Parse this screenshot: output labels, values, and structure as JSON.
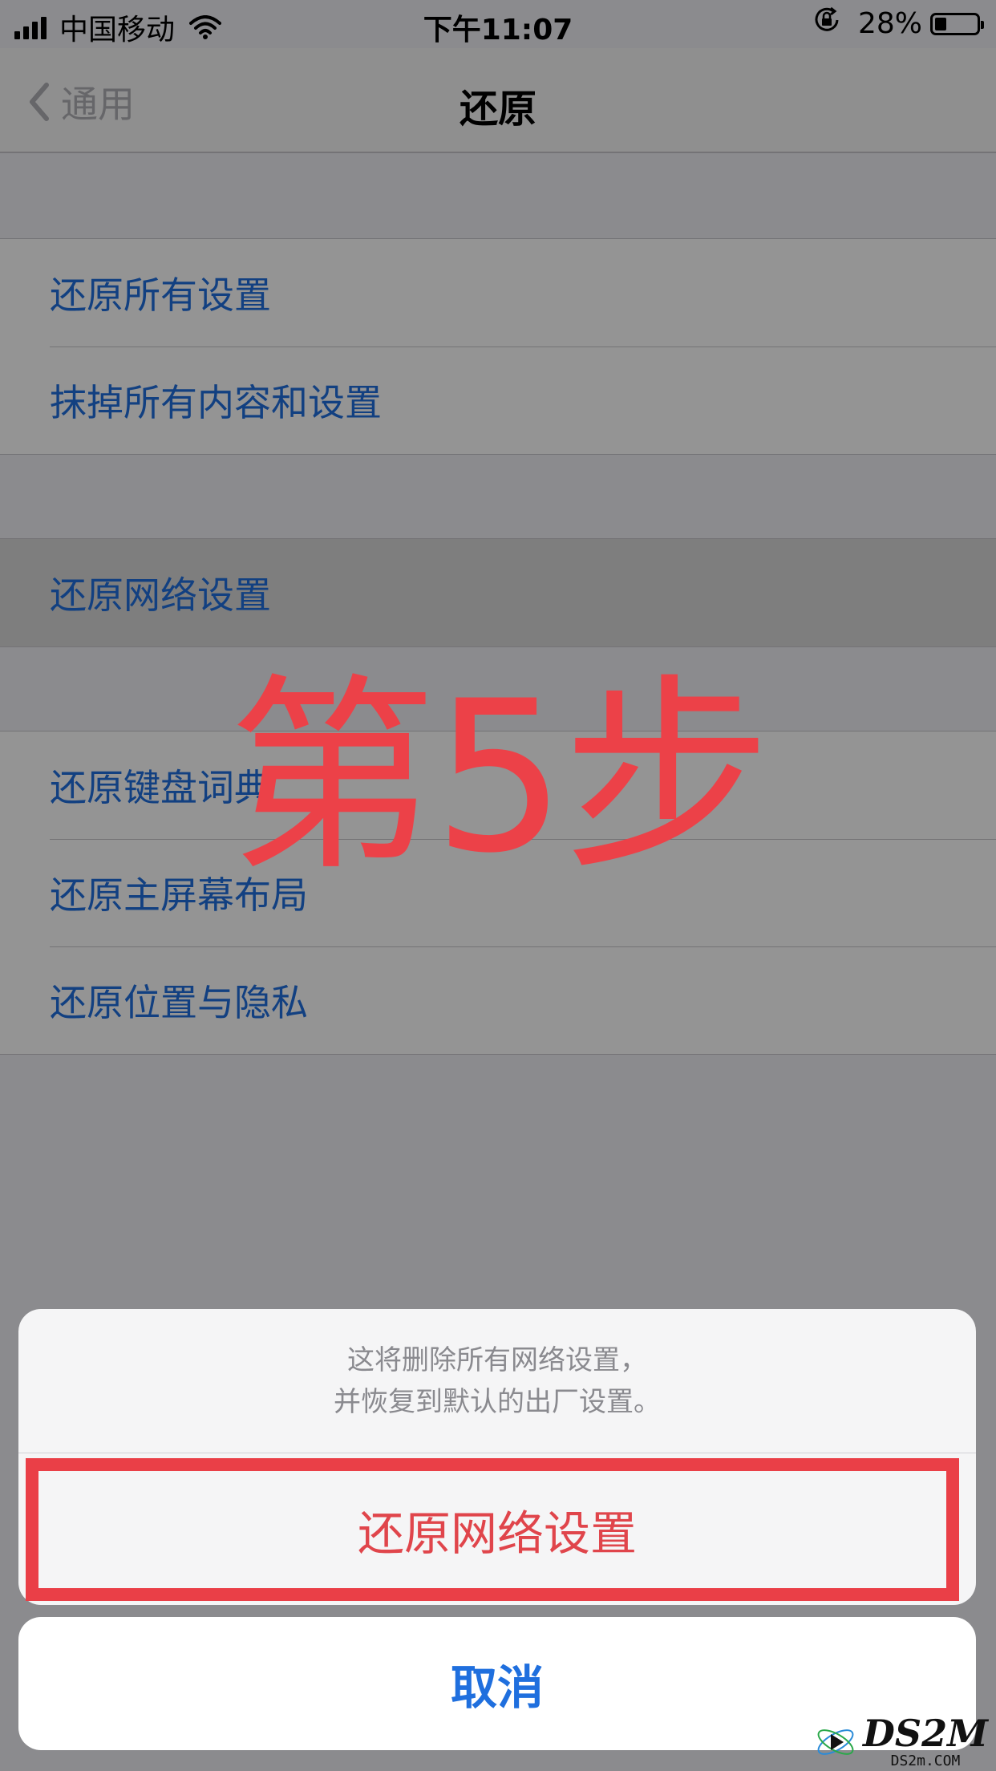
{
  "status_bar": {
    "carrier": "中国移动",
    "time": "下午11:07",
    "battery": "28%",
    "battery_level": 0.28
  },
  "nav": {
    "back_label": "通用",
    "title": "还原"
  },
  "groups": [
    {
      "items": [
        {
          "label": "还原所有设置"
        },
        {
          "label": "抹掉所有内容和设置"
        }
      ]
    },
    {
      "items": [
        {
          "label": "还原网络设置"
        }
      ]
    },
    {
      "items": [
        {
          "label": "还原键盘词典"
        },
        {
          "label": "还原主屏幕布局"
        },
        {
          "label": "还原位置与隐私"
        }
      ]
    }
  ],
  "step_text": "第5步",
  "action_sheet": {
    "message_line1": "这将删除所有网络设置，",
    "message_line2": "并恢复到默认的出厂设置。",
    "confirm_label": "还原网络设置",
    "cancel_label": "取消"
  },
  "logo": {
    "main": "DS2M",
    "sub": "DS2m.COM"
  },
  "colors": {
    "link_blue": "#1f6fde",
    "destructive_red": "#e0454b",
    "annotation_red": "#ea3f47"
  },
  "icons": [
    "signal-icon",
    "wifi-icon",
    "rotation-lock-icon",
    "battery-icon",
    "chevron-left-icon",
    "logo-mark-icon"
  ]
}
